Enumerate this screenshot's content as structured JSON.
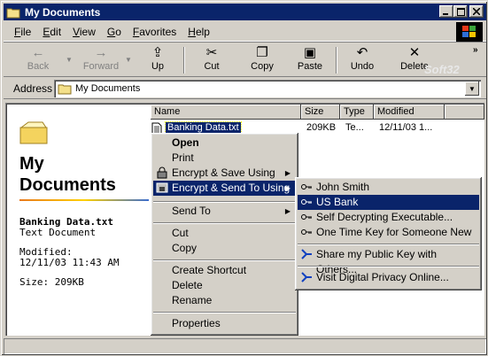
{
  "window": {
    "title": "My Documents"
  },
  "menubar": [
    "File",
    "Edit",
    "View",
    "Go",
    "Favorites",
    "Help"
  ],
  "toolbar": {
    "back": "Back",
    "forward": "Forward",
    "up": "Up",
    "cut": "Cut",
    "copy": "Copy",
    "paste": "Paste",
    "undo": "Undo",
    "delete": "Delete"
  },
  "address": {
    "label": "Address",
    "value": "My Documents"
  },
  "left_pane": {
    "title_line1": "My",
    "title_line2": "Documents",
    "file_name": "Banking Data.txt",
    "file_type": "Text Document",
    "modified_label": "Modified:",
    "modified_value": "12/11/03 11:43 AM",
    "size": "Size: 209KB"
  },
  "columns": [
    "Name",
    "Size",
    "Type",
    "Modified"
  ],
  "file_row": {
    "name": "Banking Data.txt",
    "size": "209KB",
    "type": "Te...",
    "modified": "12/11/03 1..."
  },
  "context_menu": {
    "open": "Open",
    "print": "Print",
    "encrypt_save": "Encrypt & Save Using",
    "encrypt_send": "Encrypt & Send To Using",
    "send_to": "Send To",
    "cut": "Cut",
    "copy": "Copy",
    "create_shortcut": "Create Shortcut",
    "delete": "Delete",
    "rename": "Rename",
    "properties": "Properties"
  },
  "submenu": {
    "john_smith": "John Smith",
    "us_bank": "US Bank",
    "self_decrypting": "Self Decrypting Executable...",
    "one_time_key": "One Time Key for Someone New",
    "share_key": "Share my Public Key with Others...",
    "visit": "Visit Digital Privacy Online..."
  },
  "watermark": "Soft32",
  "colors": {
    "titlebar": "#0a246a",
    "selection": "#0a246a",
    "face": "#d4d0c8"
  }
}
